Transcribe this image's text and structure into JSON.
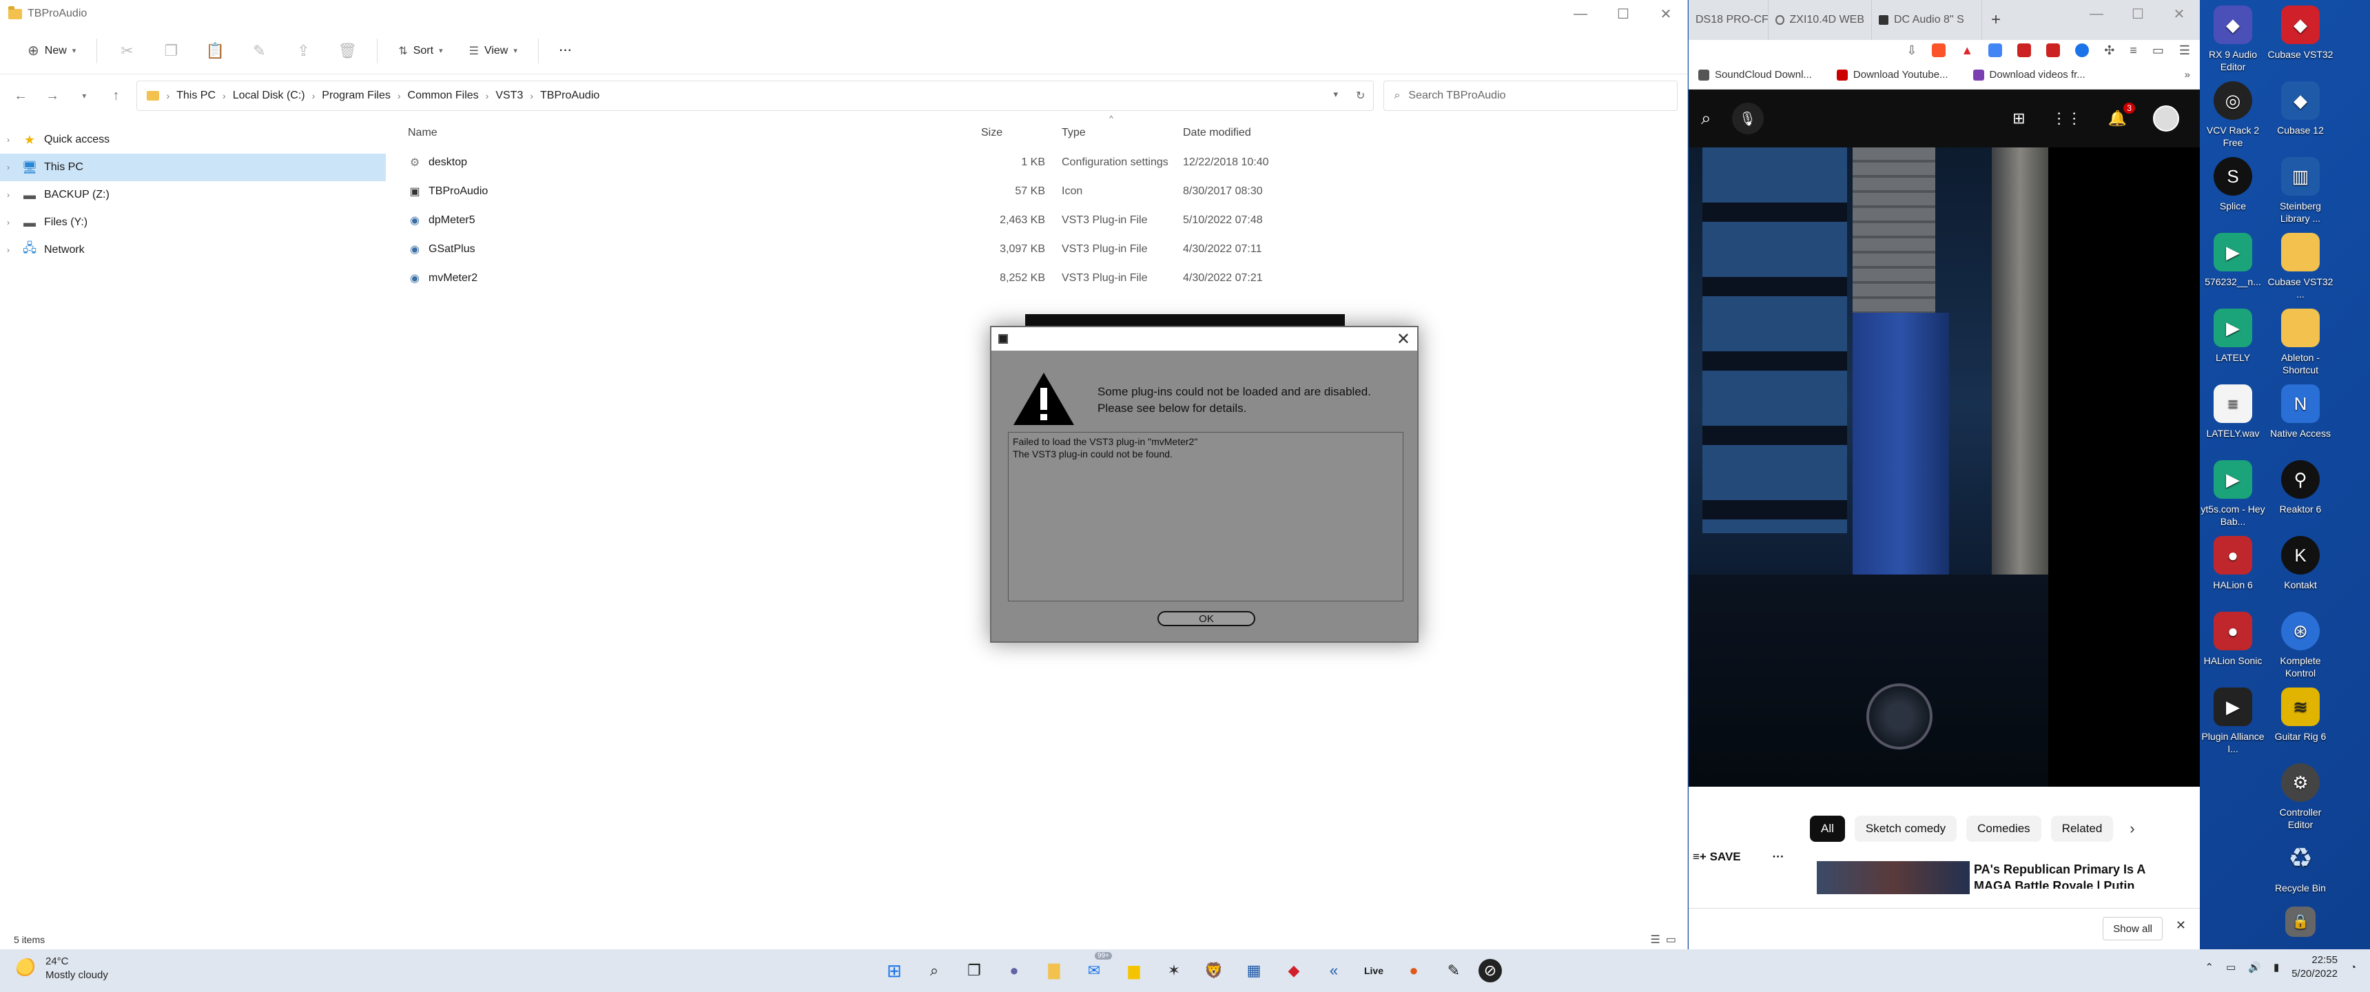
{
  "explorer": {
    "title": "TBProAudio",
    "toolbar": {
      "new": "New",
      "sort": "Sort",
      "view": "View",
      "more": "···"
    },
    "breadcrumb": [
      "This PC",
      "Local Disk (C:)",
      "Program Files",
      "Common Files",
      "VST3",
      "TBProAudio"
    ],
    "search_placeholder": "Search TBProAudio",
    "nav": [
      {
        "label": "Quick access",
        "icon": "star-icon"
      },
      {
        "label": "This PC",
        "icon": "monitor-icon",
        "selected": true
      },
      {
        "label": "BACKUP (Z:)",
        "icon": "drive-icon"
      },
      {
        "label": "Files (Y:)",
        "icon": "drive-icon"
      },
      {
        "label": "Network",
        "icon": "network-icon"
      }
    ],
    "columns": {
      "name": "Name",
      "size": "Size",
      "type": "Type",
      "date": "Date modified"
    },
    "files": [
      {
        "name": "desktop",
        "size": "1 KB",
        "type": "Configuration settings",
        "date": "12/22/2018 10:40",
        "icon": "settings-file-icon"
      },
      {
        "name": "TBProAudio",
        "size": "57 KB",
        "type": "Icon",
        "date": "8/30/2017 08:30",
        "icon": "image-file-icon"
      },
      {
        "name": "dpMeter5",
        "size": "2,463 KB",
        "type": "VST3 Plug-in File",
        "date": "5/10/2022 07:48",
        "icon": "plugin-file-icon"
      },
      {
        "name": "GSatPlus",
        "size": "3,097 KB",
        "type": "VST3 Plug-in File",
        "date": "4/30/2022 07:11",
        "icon": "plugin-file-icon"
      },
      {
        "name": "mvMeter2",
        "size": "8,252 KB",
        "type": "VST3 Plug-in File",
        "date": "4/30/2022 07:21",
        "icon": "plugin-file-icon"
      }
    ],
    "status": "5 items"
  },
  "dialog": {
    "message_line1": "Some plug-ins could not be loaded and are disabled.",
    "message_line2": "Please see below for details.",
    "details": "Failed to load the VST3 plug-in \"mvMeter2\"\nThe VST3 plug-in could not be found.",
    "ok": "OK"
  },
  "browser": {
    "tabs": [
      {
        "label": "DS18 PRO-CF",
        "color": "#888888"
      },
      {
        "label": "ZXI10.4D WEB",
        "color": "#555555"
      },
      {
        "label": "DC Audio 8\" S",
        "color": "#333333"
      }
    ],
    "bookmarks": [
      {
        "label": "SoundCloud Downl...",
        "color": "#555555"
      },
      {
        "label": "Download Youtube...",
        "color": "#cc0000"
      },
      {
        "label": "Download videos fr...",
        "color": "#7a3fb0"
      }
    ],
    "notifications_count": "3",
    "chips": [
      "All",
      "Sketch comedy",
      "Comedies",
      "Related"
    ],
    "save": "SAVE",
    "more": "···",
    "rec_title": "PA's Republican Primary Is A MAGA Battle Royale | Putin",
    "show_all": "Show all"
  },
  "desktop": [
    {
      "label": "RX 9 Audio Editor",
      "icon": "rx9-icon",
      "color": "#4b4fb8"
    },
    {
      "label": "Cubase VST32",
      "icon": "cubase-icon",
      "color": "#d0202a"
    },
    {
      "label": "VCV Rack 2 Free",
      "icon": "vcv-rack-icon",
      "color": "#222222"
    },
    {
      "label": "Cubase 12",
      "icon": "cubase-icon",
      "color": "#1e5aa8"
    },
    {
      "label": "Splice",
      "icon": "splice-icon",
      "color": "#111111"
    },
    {
      "label": "Steinberg Library ...",
      "icon": "steinberg-icon",
      "color": "#1e5aa8"
    },
    {
      "label": "576232__n...",
      "icon": "wav-file-icon",
      "color": "#1ba37a"
    },
    {
      "label": "Cubase VST32 ...",
      "icon": "folder-icon",
      "color": "#f2c14e"
    },
    {
      "label": "LATELY",
      "icon": "wav-file-icon",
      "color": "#1ba37a"
    },
    {
      "label": "Ableton - Shortcut",
      "icon": "folder-icon",
      "color": "#f2c14e"
    },
    {
      "label": "LATELY.wav",
      "icon": "document-icon",
      "color": "#f4f4f4"
    },
    {
      "label": "Native Access",
      "icon": "native-access-icon",
      "color": "#2a6fd6"
    },
    {
      "label": "yt5s.com - Hey Bab...",
      "icon": "mp3-file-icon",
      "color": "#1ba37a"
    },
    {
      "label": "Reaktor 6",
      "icon": "reaktor-icon",
      "color": "#111111"
    },
    {
      "label": "HALion 6",
      "icon": "halion-icon",
      "color": "#c0272d"
    },
    {
      "label": "Kontakt",
      "icon": "kontakt-icon",
      "color": "#111111"
    },
    {
      "label": "HALion Sonic",
      "icon": "halion-icon",
      "color": "#c0272d"
    },
    {
      "label": "Komplete Kontrol",
      "icon": "komplete-icon",
      "color": "#2a6fd6"
    },
    {
      "label": "Plugin Alliance I...",
      "icon": "plugin-alliance-icon",
      "color": "#222222"
    },
    {
      "label": "Guitar Rig 6",
      "icon": "guitar-rig-icon",
      "color": "#e0b400"
    },
    {
      "label": "Controller Editor",
      "icon": "controller-icon",
      "color": "#444444"
    },
    {
      "label": "Recycle Bin",
      "icon": "recycle-bin-icon",
      "color": "#9fc4ea"
    }
  ],
  "taskbar": {
    "temp": "24°C",
    "weather": "Mostly cloudy",
    "mail_badge": "99+",
    "time": "22:55",
    "date": "5/20/2022"
  }
}
